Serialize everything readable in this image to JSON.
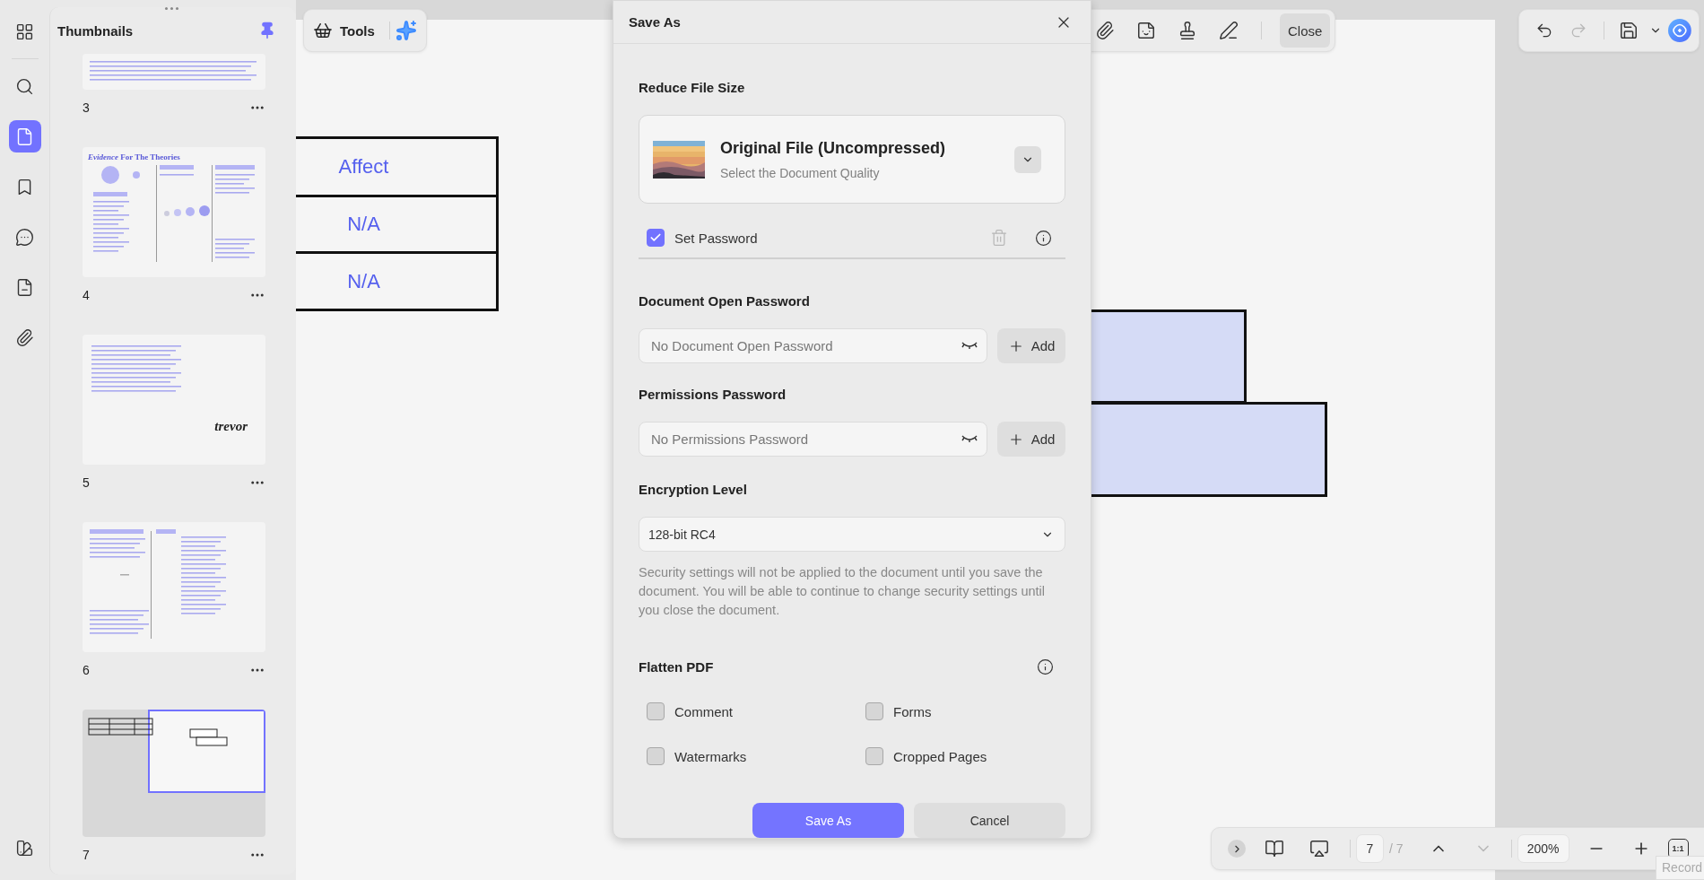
{
  "rail": {
    "items": [
      {
        "selected": false
      },
      {
        "selected": false
      },
      {
        "selected": true
      },
      {
        "selected": false
      },
      {
        "selected": false
      },
      {
        "selected": false
      },
      {
        "selected": false
      },
      {
        "selected": false
      }
    ]
  },
  "thumbnails": {
    "title": "Thumbnails",
    "pages": [
      {
        "number": "3",
        "kind": "text",
        "selected": false
      },
      {
        "number": "4",
        "kind": "diagram",
        "heading": "*Evidence* For The Theories",
        "selected": false
      },
      {
        "number": "5",
        "kind": "signature",
        "signature": "trevor",
        "selected": false
      },
      {
        "number": "6",
        "kind": "columns",
        "selected": false
      },
      {
        "number": "7",
        "kind": "table",
        "selected": true
      }
    ]
  },
  "toolbar": {
    "tools_label": "Tools",
    "close_label": "Close",
    "redo_disabled": true
  },
  "document": {
    "table_rows": [
      "Affect",
      "N/A",
      "N/A"
    ]
  },
  "dialog": {
    "title": "Save As",
    "reduce_title": "Reduce File Size",
    "quality": {
      "title": "Original File (Uncompressed)",
      "subtitle": "Select the Document Quality"
    },
    "set_password": {
      "label": "Set Password",
      "checked": true
    },
    "open_password": {
      "title": "Document Open Password",
      "placeholder": "No Document Open Password",
      "button": "Add"
    },
    "permissions_password": {
      "title": "Permissions Password",
      "placeholder": "No Permissions Password",
      "button": "Add"
    },
    "encryption": {
      "title": "Encryption Level",
      "value": "128-bit RC4"
    },
    "note": "Security settings will not be applied to the document until you save the document. You will be able to continue to change security settings until you close the document.",
    "flatten": {
      "title": "Flatten PDF",
      "options": [
        {
          "label": "Comment",
          "checked": false
        },
        {
          "label": "Forms",
          "checked": false
        },
        {
          "label": "Watermarks",
          "checked": false
        },
        {
          "label": "Cropped Pages",
          "checked": false
        }
      ]
    },
    "buttons": {
      "primary": "Save As",
      "secondary": "Cancel"
    }
  },
  "bottom_bar": {
    "page": "7",
    "total": "/ 7",
    "next_disabled": true,
    "zoom": "200%",
    "actual_size": "1:1"
  },
  "tooltip": "Record"
}
